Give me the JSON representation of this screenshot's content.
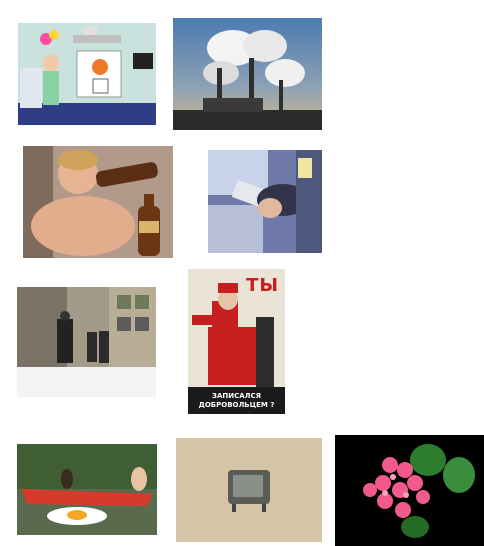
{
  "gallery": {
    "images": [
      {
        "name": "cartoon-hospital-image",
        "subject": "cartoon hospital room"
      },
      {
        "name": "factory-smoke-image",
        "subject": "factory chimneys with smoke"
      },
      {
        "name": "man-drinking-bottle-image",
        "subject": "man drinking from bottle"
      },
      {
        "name": "person-at-window-image",
        "subject": "person slumped at window"
      },
      {
        "name": "snowy-street-image",
        "subject": "people walking on snowy street"
      },
      {
        "name": "soviet-poster-image",
        "subject": "soviet propaganda poster"
      },
      {
        "name": "boat-fried-egg-image",
        "subject": "people in boat with fried egg"
      },
      {
        "name": "old-tv-image",
        "subject": "old tv on wall"
      },
      {
        "name": "pink-flowers-image",
        "subject": "pink geranium flowers"
      }
    ],
    "poster": {
      "top_text": "ТЫ",
      "bottom_line1": "ЗАПИСАЛСЯ",
      "bottom_line2": "ДОБРОВОЛЬЦЕМ ?"
    },
    "colors": {
      "background": "#ffffff",
      "poster_red": "#c51f1f",
      "poster_black": "#1b1b1b"
    }
  }
}
